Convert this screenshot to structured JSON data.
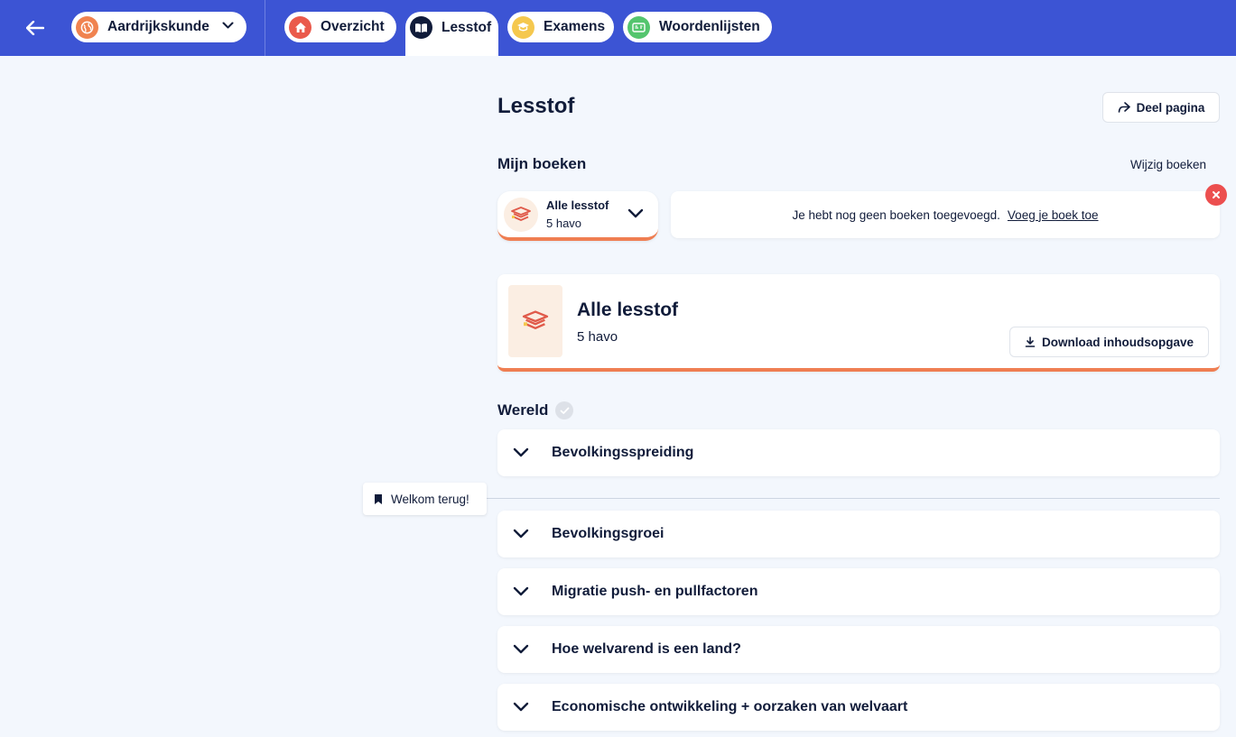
{
  "topbar": {
    "subject": "Aardrijkskunde",
    "tabs": [
      {
        "label": "Overzicht",
        "icon": "home-icon",
        "color": "#ea5a4c"
      },
      {
        "label": "Lesstof",
        "icon": "book-icon",
        "color": "#111c3a"
      },
      {
        "label": "Examens",
        "icon": "graduation-cap-icon",
        "color": "#f5c84e"
      },
      {
        "label": "Woordenlijsten",
        "icon": "word-list-icon",
        "color": "#54c56e"
      }
    ],
    "active_tab": "Lesstof",
    "accent": "#3c54d4"
  },
  "main": {
    "title": "Lesstof",
    "share_label": "Deel pagina",
    "my_books_title": "Mijn boeken",
    "edit_books_label": "Wijzig boeken",
    "book_select": {
      "title": "Alle lesstof",
      "level": "5 havo"
    },
    "notice": {
      "text": "Je hebt nog geen boeken toegevoegd.",
      "link": "Voeg je boek toe"
    },
    "book_card": {
      "title": "Alle lesstof",
      "level": "5 havo",
      "download_label": "Download inhoudsopgave"
    },
    "world_title": "Wereld",
    "welcome_label": "Welkom terug!",
    "chapters": [
      "Bevolkingsspreiding",
      "Bevolkingsgroei",
      "Migratie push- en pullfactoren",
      "Hoe welvarend is een land?",
      "Economische ontwikkeling + oorzaken van welvaart"
    ],
    "accent_orange": "#ef7e52"
  }
}
